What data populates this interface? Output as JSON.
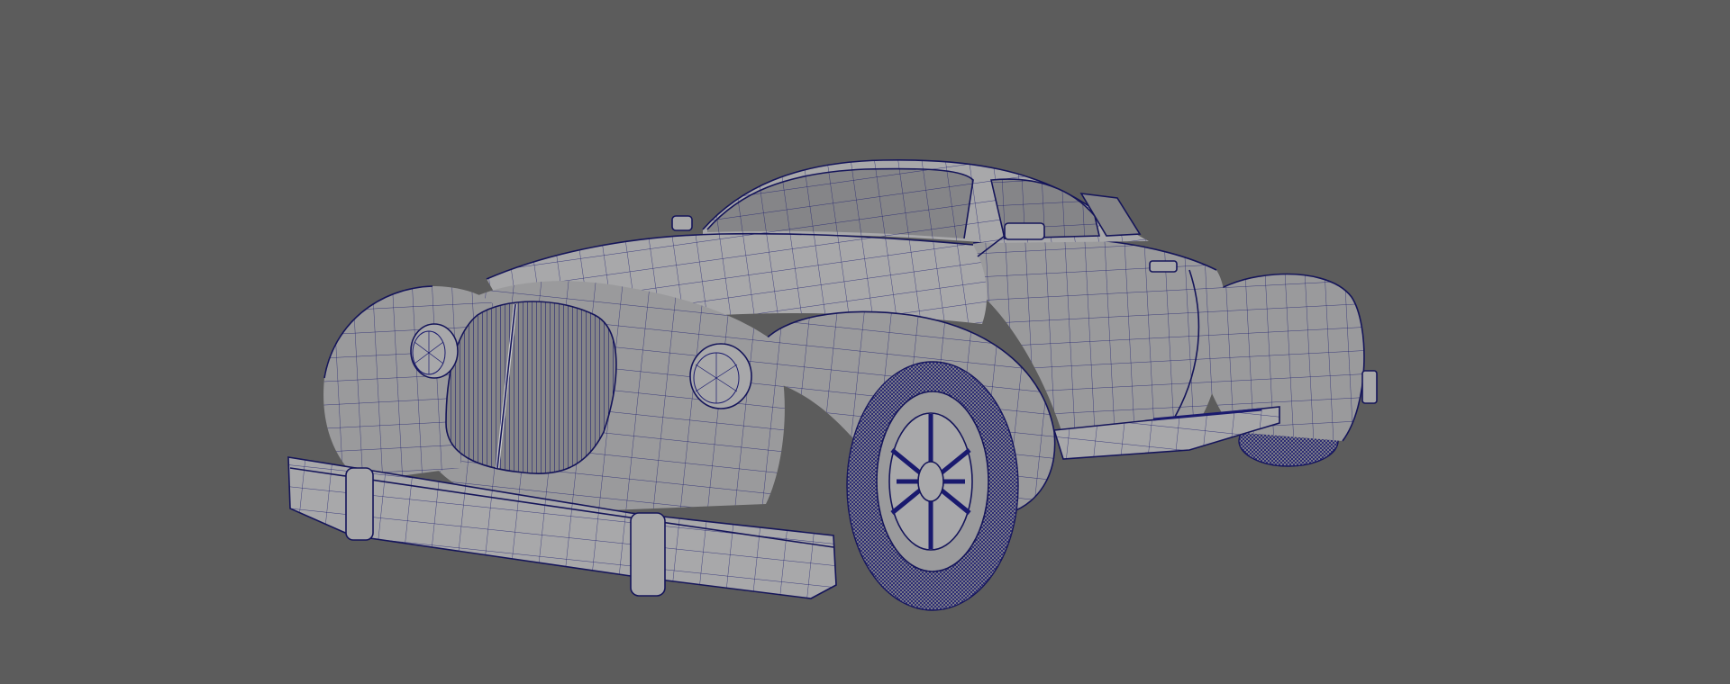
{
  "viewport": {
    "background": "#5c5c5c",
    "mesh_color": "#1a1a6e",
    "surface_color": "#9a9a9c"
  },
  "model": {
    "subject": "classic-coupe-wireframe",
    "display_mode": "wireframe-on-shaded"
  }
}
